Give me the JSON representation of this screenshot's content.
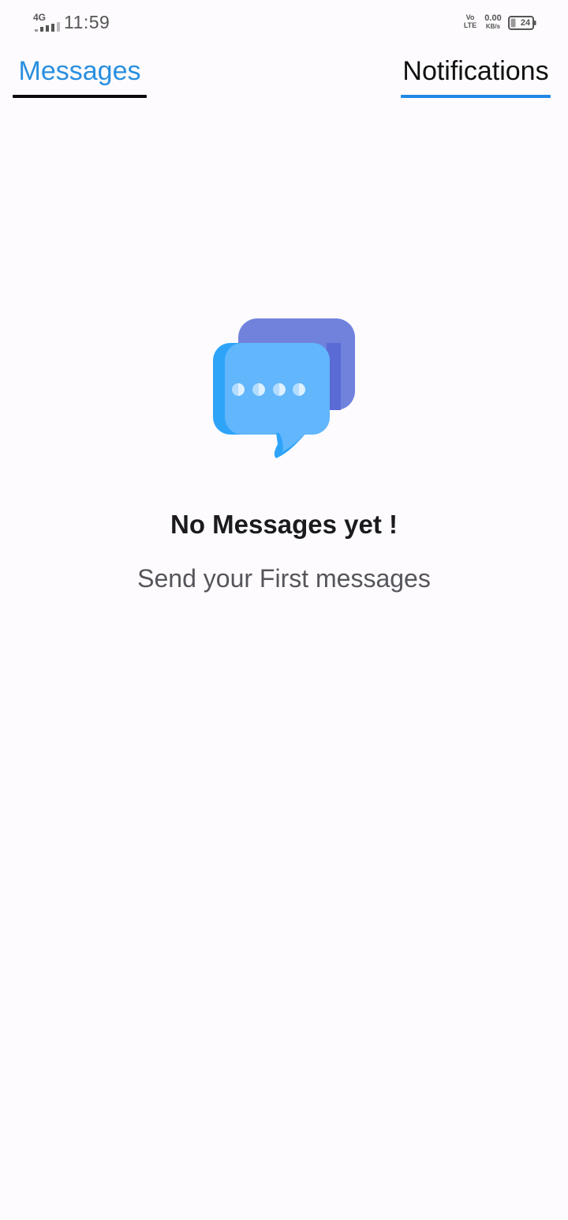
{
  "status_bar": {
    "network_type": "4G",
    "time": "11:59",
    "volte_top": "Vo",
    "volte_bottom": "LTE",
    "speed_value": "0.00",
    "speed_unit": "KB/s",
    "battery_level": "24",
    "icons": [
      "signal-icon",
      "volte-icon",
      "battery-icon"
    ]
  },
  "tabs": [
    {
      "label": "Messages",
      "selected": true
    },
    {
      "label": "Notifications",
      "selected": false
    }
  ],
  "empty_state": {
    "icon": "chat-bubbles-icon",
    "title": "No Messages yet !",
    "subtitle": "Send your First messages"
  },
  "colors": {
    "accent_blue": "#2a8fe0",
    "indicator_blue": "#1e88e5",
    "background": "#fdfbfd",
    "bubble_back": "#7182dd",
    "bubble_front": "#61b6fc",
    "bubble_edge": "#2ea4f8"
  }
}
